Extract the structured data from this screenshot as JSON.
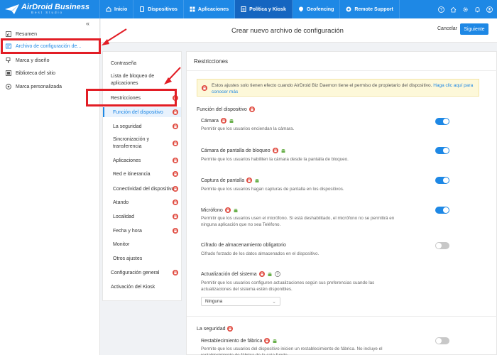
{
  "brand": {
    "name": "AirDroid Business",
    "sub": "Best Studio"
  },
  "nav": [
    {
      "label": "Inicio",
      "icon": "home-icon"
    },
    {
      "label": "Dispositivos",
      "icon": "devices-icon"
    },
    {
      "label": "Aplicaciones",
      "icon": "apps-icon"
    },
    {
      "label": "Política y Kiosk",
      "icon": "policy-icon",
      "active": true
    },
    {
      "label": "Geofencing",
      "icon": "geofence-icon"
    },
    {
      "label": "Remote Support",
      "icon": "support-icon"
    }
  ],
  "sidebar": {
    "items": [
      {
        "label": "Resumen",
        "icon": "overview-icon"
      },
      {
        "label": "Archivo de configuración de...",
        "icon": "config-file-icon",
        "active": true
      },
      {
        "label": "Marca y diseño",
        "icon": "brush-icon"
      },
      {
        "label": "Biblioteca del sitio",
        "icon": "library-icon"
      },
      {
        "label": "Marca personalizada",
        "icon": "custom-brand-icon"
      }
    ]
  },
  "header": {
    "title": "Crear nuevo archivo de configuración",
    "cancel": "Cancelar",
    "next": "Siguiente"
  },
  "menu": {
    "items": [
      {
        "label": "Contraseña"
      },
      {
        "label": "Lista de bloqueo de aplicaciones"
      },
      {
        "label": "Restricciones"
      },
      {
        "label": "Función del dispositivo"
      },
      {
        "label": "La seguridad"
      },
      {
        "label": "Sincronización y transferencia"
      },
      {
        "label": "Aplicaciones"
      },
      {
        "label": "Red e itinerancia"
      },
      {
        "label": "Conectividad del dispositivo"
      },
      {
        "label": "Atando"
      },
      {
        "label": "Localidad"
      },
      {
        "label": "Fecha y hora"
      },
      {
        "label": "Monitor"
      },
      {
        "label": "Otros ajustes"
      },
      {
        "label": "Configuración general"
      },
      {
        "label": "Activación del Kiosk"
      }
    ]
  },
  "panel": {
    "title": "Restricciones",
    "notice_text": "Estos ajustes solo tienen efecto cuando AirDroid Biz Daemon tiene el permiso de propietario del dispositivo.",
    "notice_link": "Haga clic aquí para conocer más",
    "section1": "Función del dispositivo",
    "settings": [
      {
        "title": "Cámara",
        "desc": "Permitir que los usuarios enciendan la cámara.",
        "on": true
      },
      {
        "title": "Cámara de pantalla de bloqueo",
        "desc": "Permite que los usuarios habiliten la cámara desde la pantalla de bloqueo.",
        "on": true
      },
      {
        "title": "Captura de pantalla",
        "desc": "Permite que los usuarios hagan capturas de pantalla en los dispositivos.",
        "on": true
      },
      {
        "title": "Micrófono",
        "desc": "Permitir que los usuarios usen el micrófono. Si está deshabilitado, el micrófono no se permitirá en ninguna aplicación que no sea Teléfono.",
        "on": true
      },
      {
        "title": "Cifrado de almacenamiento obligatorio",
        "desc": "Cifrado forzado de los datos almacenados en el dispositivo.",
        "on": false
      },
      {
        "title": "Actualización del sistema",
        "desc": "Permitir que los usuarios configuren actualizaciones según sus preferencias cuando las actualizaciones del sistema estén disponibles."
      }
    ],
    "select_value": "Ninguna",
    "section2": "La seguridad",
    "settings2": [
      {
        "title": "Restablecimiento de fábrica",
        "desc": "Permite que los usuarios del dispositivo inicien un restablecimiento de fábrica. No incluye el restablecimiento de fábrica de la caja fuerte.",
        "on": false
      }
    ]
  },
  "colors": {
    "primary": "#1e88e5",
    "highlight": "#e21d25",
    "lock": "#e04a3f",
    "android": "#6ab04c"
  }
}
